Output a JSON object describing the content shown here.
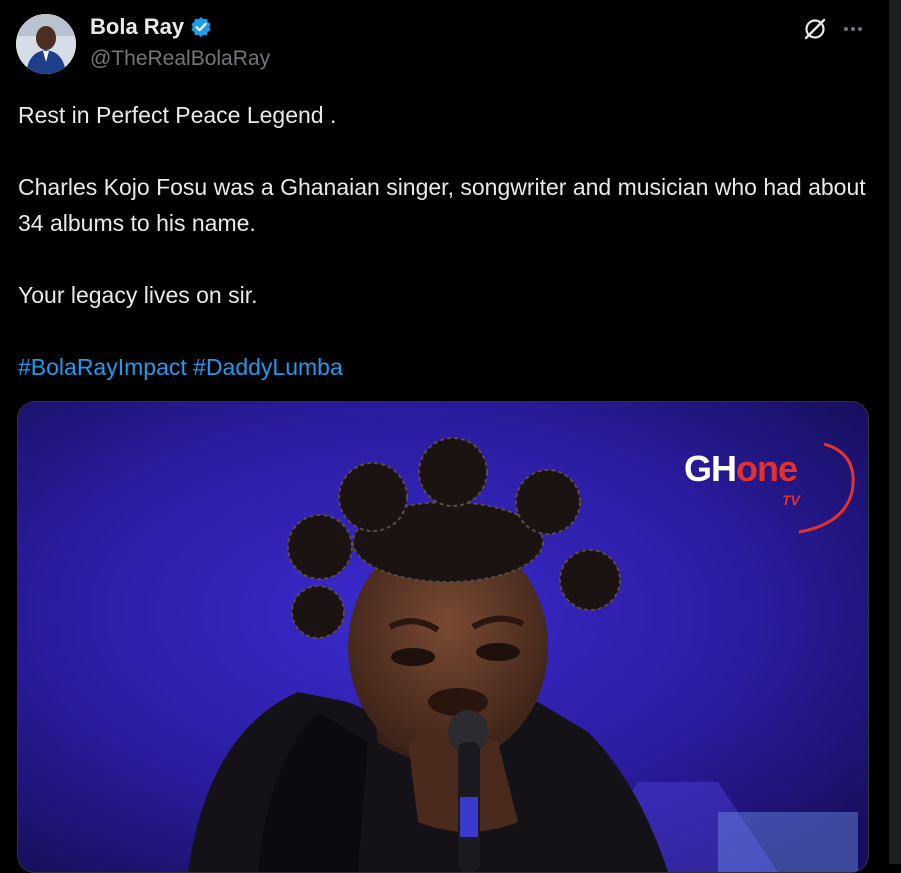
{
  "author": {
    "name": "Bola Ray",
    "handle": "@TheRealBolaRay",
    "verified_color": "#1d9bf0"
  },
  "tweet": {
    "line1": "Rest in Perfect Peace Legend .",
    "line2": "Charles Kojo Fosu was a Ghanaian singer, songwriter and musician who had about 34 albums to his name.",
    "line3": "Your legacy lives on sir.",
    "hashtags": [
      "#BolaRayImpact",
      "#DaddyLumba"
    ]
  },
  "media": {
    "logo_gh": "GH",
    "logo_one": "one",
    "logo_tv": "TV",
    "background_color": "#2b1c9c",
    "logo_accent": "#e5312b"
  },
  "icons": {
    "grok": "grok-icon",
    "more": "more-icon",
    "verified": "verified-badge-icon"
  }
}
